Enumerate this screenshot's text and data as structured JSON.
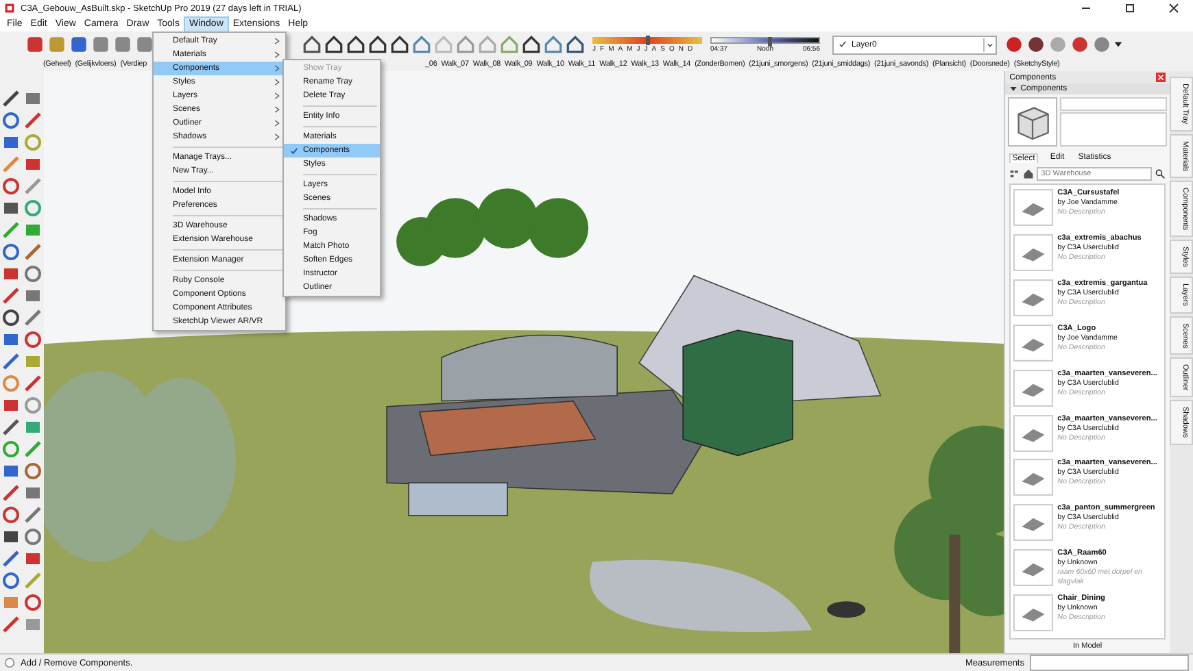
{
  "window": {
    "title": "C3A_Gebouw_AsBuilt.skp - SketchUp Pro 2019 (27 days left in TRIAL)"
  },
  "menu_bar": [
    {
      "label": "File",
      "selected": false
    },
    {
      "label": "Edit",
      "selected": false
    },
    {
      "label": "View",
      "selected": false
    },
    {
      "label": "Camera",
      "selected": false
    },
    {
      "label": "Draw",
      "selected": false
    },
    {
      "label": "Tools",
      "selected": false
    },
    {
      "label": "Window",
      "selected": true
    },
    {
      "label": "Extensions",
      "selected": false
    },
    {
      "label": "Help",
      "selected": false
    }
  ],
  "window_menu": [
    {
      "kind": "item",
      "label": "Default Tray",
      "submenu": true,
      "selected": false
    },
    {
      "kind": "item",
      "label": "Materials",
      "submenu": true,
      "selected": false
    },
    {
      "kind": "item",
      "label": "Components",
      "submenu": true,
      "selected": true
    },
    {
      "kind": "item",
      "label": "Styles",
      "submenu": true,
      "selected": false
    },
    {
      "kind": "item",
      "label": "Layers",
      "submenu": true,
      "selected": false
    },
    {
      "kind": "item",
      "label": "Scenes",
      "submenu": true,
      "selected": false
    },
    {
      "kind": "item",
      "label": "Outliner",
      "submenu": true,
      "selected": false
    },
    {
      "kind": "item",
      "label": "Shadows",
      "submenu": true,
      "selected": false
    },
    {
      "kind": "separator"
    },
    {
      "kind": "item",
      "label": "Manage Trays...",
      "submenu": false,
      "selected": false
    },
    {
      "kind": "item",
      "label": "New Tray...",
      "submenu": false,
      "selected": false
    },
    {
      "kind": "separator"
    },
    {
      "kind": "item",
      "label": "Model Info",
      "submenu": false,
      "selected": false
    },
    {
      "kind": "item",
      "label": "Preferences",
      "submenu": false,
      "selected": false
    },
    {
      "kind": "separator"
    },
    {
      "kind": "item",
      "label": "3D Warehouse",
      "submenu": false,
      "selected": false
    },
    {
      "kind": "item",
      "label": "Extension Warehouse",
      "submenu": false,
      "selected": false
    },
    {
      "kind": "separator"
    },
    {
      "kind": "item",
      "label": "Extension Manager",
      "submenu": false,
      "selected": false
    },
    {
      "kind": "separator"
    },
    {
      "kind": "item",
      "label": "Ruby Console",
      "submenu": false,
      "selected": false
    },
    {
      "kind": "item",
      "label": "Component Options",
      "submenu": false,
      "selected": false
    },
    {
      "kind": "item",
      "label": "Component Attributes",
      "submenu": false,
      "selected": false
    },
    {
      "kind": "item",
      "label": "SketchUp Viewer AR/VR",
      "submenu": false,
      "selected": false
    }
  ],
  "components_submenu": [
    {
      "kind": "item",
      "label": "Show Tray",
      "disabled": true,
      "checked": false,
      "selected": false
    },
    {
      "kind": "item",
      "label": "Rename Tray",
      "disabled": false,
      "checked": false,
      "selected": false
    },
    {
      "kind": "item",
      "label": "Delete Tray",
      "disabled": false,
      "checked": false,
      "selected": false
    },
    {
      "kind": "separator"
    },
    {
      "kind": "item",
      "label": "Entity Info",
      "disabled": false,
      "checked": false,
      "selected": false
    },
    {
      "kind": "separator"
    },
    {
      "kind": "item",
      "label": "Materials",
      "disabled": false,
      "checked": false,
      "selected": false
    },
    {
      "kind": "item",
      "label": "Components",
      "disabled": false,
      "checked": true,
      "selected": true
    },
    {
      "kind": "item",
      "label": "Styles",
      "disabled": false,
      "checked": false,
      "selected": false
    },
    {
      "kind": "separator"
    },
    {
      "kind": "item",
      "label": "Layers",
      "disabled": false,
      "checked": false,
      "selected": false
    },
    {
      "kind": "item",
      "label": "Scenes",
      "disabled": false,
      "checked": false,
      "selected": false
    },
    {
      "kind": "separator"
    },
    {
      "kind": "item",
      "label": "Shadows",
      "disabled": false,
      "checked": false,
      "selected": false
    },
    {
      "kind": "item",
      "label": "Fog",
      "disabled": false,
      "checked": false,
      "selected": false
    },
    {
      "kind": "item",
      "label": "Match Photo",
      "disabled": false,
      "checked": false,
      "selected": false
    },
    {
      "kind": "item",
      "label": "Soften Edges",
      "disabled": false,
      "checked": false,
      "selected": false
    },
    {
      "kind": "item",
      "label": "Instructor",
      "disabled": false,
      "checked": false,
      "selected": false
    },
    {
      "kind": "item",
      "label": "Outliner",
      "disabled": false,
      "checked": false,
      "selected": false
    }
  ],
  "shadow_months": {
    "labels": [
      "J",
      "F",
      "M",
      "A",
      "M",
      "J",
      "J",
      "A",
      "S",
      "O",
      "N",
      "D"
    ],
    "level": 0.5
  },
  "shadow_times": {
    "labels": [
      "04:37",
      "Noon",
      "06:56"
    ],
    "level": 0.55
  },
  "layer_dropdown": {
    "value": "Layer0"
  },
  "scene_tabs_left": [
    "(Geheel)",
    "(Gelijkvloers)",
    "(Verdiep"
  ],
  "scene_tabs_right": [
    "_06",
    "Walk_07",
    "Walk_08",
    "Walk_09",
    "Walk_10",
    "Walk_11",
    "Walk_12",
    "Walk_13",
    "Walk_14",
    "(ZonderBomen)",
    "(21juni_smorgens)",
    "(21juni_smiddags)",
    "(21juni_savonds)",
    "(Plansicht)",
    "(Doorsnede)",
    "(SketchyStyle)"
  ],
  "tray": {
    "title": "Components",
    "section": "Components",
    "tabs": [
      {
        "label": "Select",
        "selected": true
      },
      {
        "label": "Edit",
        "selected": false
      },
      {
        "label": "Statistics",
        "selected": false
      }
    ],
    "search": {
      "placeholder": "3D Warehouse"
    },
    "items": [
      {
        "name": "C3A_Cursustafel",
        "author": "by Joe Vandamme",
        "description": "No Description"
      },
      {
        "name": "c3a_extremis_abachus",
        "author": "by C3A Userclublid",
        "description": "No Description"
      },
      {
        "name": "c3a_extremis_gargantua",
        "author": "by C3A Userclublid",
        "description": "No Description"
      },
      {
        "name": "C3A_Logo",
        "author": "by Joe Vandamme",
        "description": "No Description"
      },
      {
        "name": "c3a_maarten_vanseveren...",
        "author": "by C3A Userclublid",
        "description": "No Description"
      },
      {
        "name": "c3a_maarten_vanseveren...",
        "author": "by C3A Userclublid",
        "description": "No Description"
      },
      {
        "name": "c3a_maarten_vanseveren...",
        "author": "by C3A Userclublid",
        "description": "No Description"
      },
      {
        "name": "c3a_panton_summergreen",
        "author": "by C3A Userclublid",
        "description": "No Description"
      },
      {
        "name": "C3A_Raam60",
        "author": "by Unknown",
        "description": "raam 60x60 met dorpel en slagvlak"
      },
      {
        "name": "Chair_Dining",
        "author": "by Unknown",
        "description": "No Description"
      }
    ],
    "footer": "In Model"
  },
  "side_tabs": [
    "Default Tray",
    "Materials",
    "Components",
    "Styles",
    "Layers",
    "Scenes",
    "Outliner",
    "Shadows"
  ],
  "status_bar": {
    "message": "Add / Remove Components.",
    "measurements_label": "Measurements"
  }
}
